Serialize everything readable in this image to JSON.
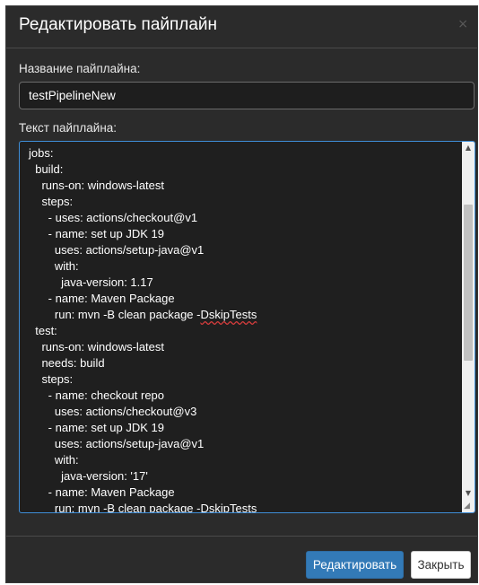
{
  "modal": {
    "title": "Редактировать пайплайн",
    "close_icon": "×"
  },
  "form": {
    "name_label": "Название пайплайна:",
    "name_value": "testPipelineNew",
    "text_label": "Текст пайплайна:"
  },
  "editor": {
    "lines": [
      "jobs:",
      "  build:",
      "    runs-on: windows-latest",
      "    steps:",
      "      - uses: actions/checkout@v1",
      "      - name: set up JDK 19",
      "        uses: actions/setup-java@v1",
      "        with:",
      "          java-version: 1.17",
      "      - name: Maven Package",
      "        run: mvn -B clean package -",
      "  test:",
      "    runs-on: windows-latest",
      "    needs: build",
      "    steps:",
      "      - name: checkout repo",
      "        uses: actions/checkout@v3",
      "      - name: set up JDK 19",
      "        uses: actions/setup-java@v1",
      "        with:",
      "          java-version: '17'",
      "      - name: Maven Package",
      "        run: mvn -B clean package -"
    ],
    "misspelled_word": "DskipTests",
    "scroll_up_icon": "▲",
    "scroll_down_icon": "▼",
    "resize_icon": "◢"
  },
  "footer": {
    "edit_label": "Редактировать",
    "close_label": "Закрыть"
  },
  "colors": {
    "background": "#2b2b2b",
    "editor_bg": "#1f1f1f",
    "focus_border": "#3f8ed8",
    "primary": "#337ab7"
  }
}
